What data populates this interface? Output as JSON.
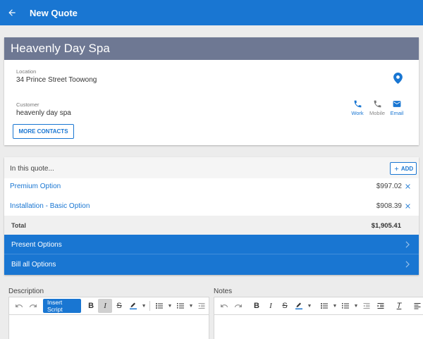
{
  "appbar": {
    "title": "New Quote",
    "back_icon": "arrow-left-icon"
  },
  "customer_card": {
    "name": "Heavenly Day Spa",
    "location_label": "Location",
    "location_value": "34 Prince Street Toowong",
    "customer_label": "Customer",
    "customer_value": "heavenly day spa",
    "contacts": [
      {
        "label": "Work",
        "icon": "phone-icon",
        "active": true
      },
      {
        "label": "Mobile",
        "icon": "phone-icon",
        "active": false
      },
      {
        "label": "Email",
        "icon": "email-icon",
        "active": true
      }
    ],
    "more_contacts_label": "MORE CONTACTS"
  },
  "quote": {
    "heading": "In this quote...",
    "add_label": "ADD",
    "items": [
      {
        "name": "Premium Option",
        "price": "$997.02"
      },
      {
        "name": "Installation - Basic Option",
        "price": "$908.39"
      }
    ],
    "total_label": "Total",
    "total_value": "$1,905.41",
    "actions": [
      "Present Options",
      "Bill all Options"
    ]
  },
  "editors": {
    "description_label": "Description",
    "notes_label": "Notes",
    "insert_script_label": "Insert Script"
  },
  "colors": {
    "primary": "#1976d2",
    "header_gray": "#6e7893",
    "contact_inactive": "#777777"
  }
}
